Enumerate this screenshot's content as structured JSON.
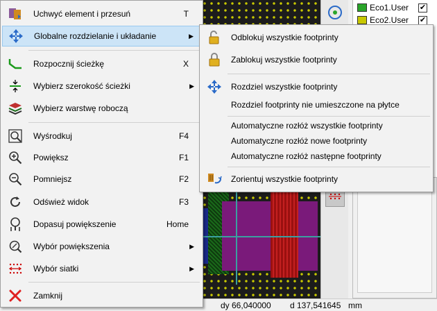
{
  "main_menu": {
    "items": [
      {
        "label": "Uchwyć element i przesuń",
        "shortcut": "T",
        "icon": "move-item-icon"
      },
      {
        "label": "Globalne rozdzielanie i układanie",
        "icon": "spread-arrows-icon"
      },
      {
        "label": "Rozpocznij ścieżkę",
        "shortcut": "X",
        "icon": "route-track-icon"
      },
      {
        "label": "Wybierz szerokość ścieżki",
        "icon": "track-width-icon"
      },
      {
        "label": "Wybierz warstwę roboczą",
        "icon": "layers-icon"
      },
      {
        "label": "Wyśrodkuj",
        "shortcut": "F4",
        "icon": "zoom-center-icon"
      },
      {
        "label": "Powiększ",
        "shortcut": "F1",
        "icon": "zoom-in-icon"
      },
      {
        "label": "Pomniejsz",
        "shortcut": "F2",
        "icon": "zoom-out-icon"
      },
      {
        "label": "Odśwież widok",
        "shortcut": "F3",
        "icon": "refresh-icon"
      },
      {
        "label": "Dopasuj powiększenie",
        "shortcut": "Home",
        "icon": "zoom-fit-icon"
      },
      {
        "label": "Wybór powiększenia",
        "icon": "zoom-select-icon"
      },
      {
        "label": "Wybór siatki",
        "icon": "grid-select-icon"
      },
      {
        "label": "Zamknij",
        "icon": "close-icon"
      }
    ]
  },
  "sub_menu": {
    "items": [
      {
        "label": "Odblokuj wszystkie footprinty",
        "icon": "unlock-icon"
      },
      {
        "label": "Zablokuj wszystkie footprinty",
        "icon": "lock-icon"
      },
      {
        "label": "Rozdziel wszystkie footprinty",
        "icon": "spread-arrows-icon"
      },
      {
        "label": "Rozdziel footprinty nie umieszczone na płytce"
      },
      {
        "label": "Automatyczne rozłóż wszystkie footprinty"
      },
      {
        "label": "Automatyczne rozłóż nowe footprinty"
      },
      {
        "label": "Automatyczne rozłóż następne footprinty"
      },
      {
        "label": "Zorientuj wszystkie footprinty",
        "icon": "orient-icon"
      }
    ]
  },
  "layers": [
    {
      "name": "Eco1.User",
      "color": "#2aa52a",
      "checked": "✔"
    },
    {
      "name": "Eco2.User",
      "color": "#c8c800",
      "checked": "✔"
    }
  ],
  "status_bar": {
    "dy": "dy 66,040000",
    "d": "d 137,541645",
    "units": "mm"
  },
  "colors": {
    "highlight": "#cce4f7",
    "menu_bg": "#f2f2f2"
  }
}
